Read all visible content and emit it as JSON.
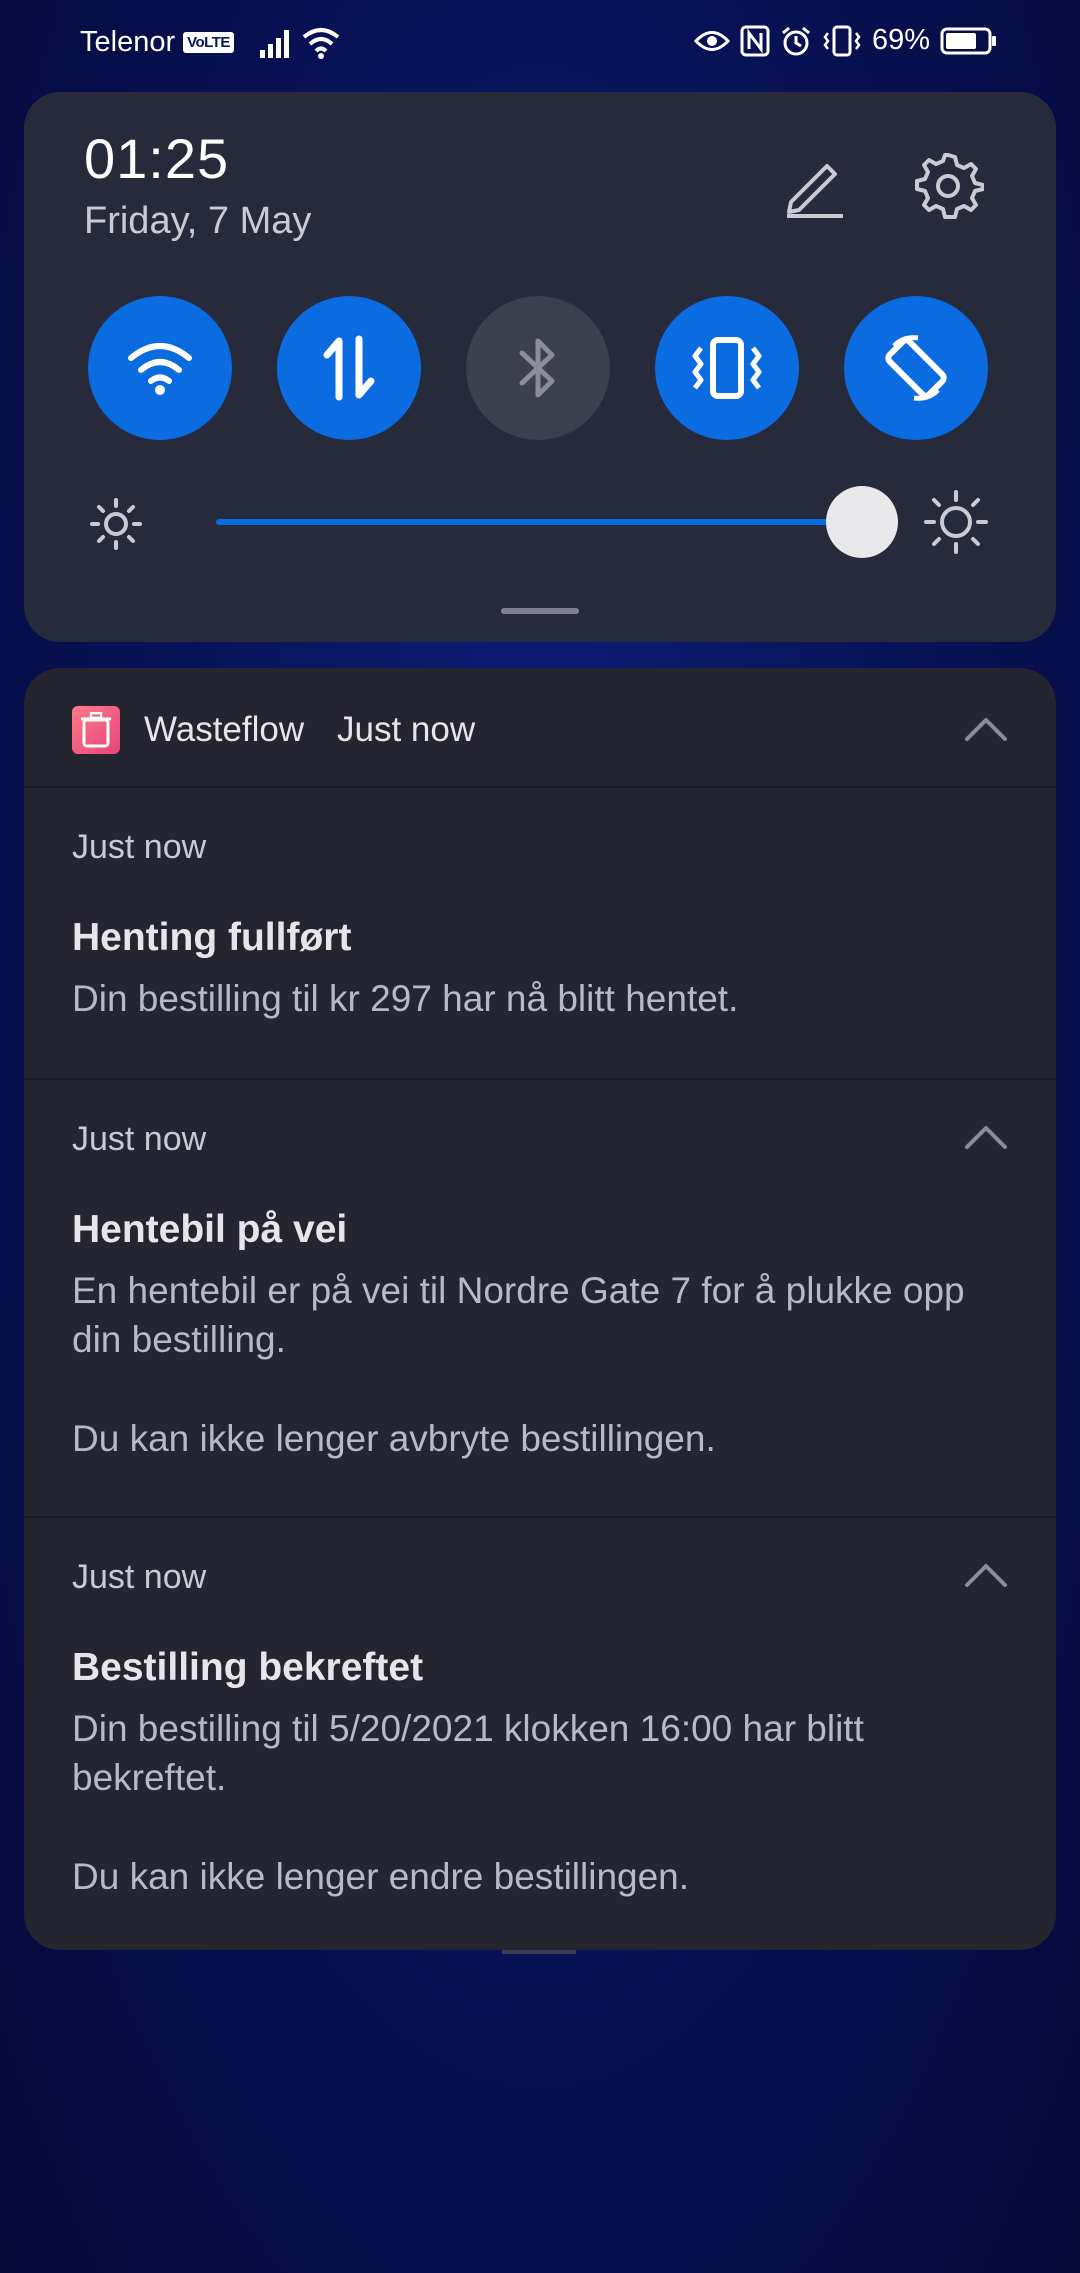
{
  "status_bar": {
    "carrier": "Telenor",
    "volte": "VoLTE",
    "battery": "69%",
    "icons": [
      "signal-icon",
      "wifi-icon",
      "eye-icon",
      "nfc-icon",
      "alarm-icon",
      "vibrate-icon",
      "battery-icon"
    ]
  },
  "quick_settings": {
    "time": "01:25",
    "date": "Friday, 7 May",
    "toggles": [
      {
        "name": "wifi",
        "state": "on"
      },
      {
        "name": "mobile-data",
        "state": "on"
      },
      {
        "name": "bluetooth",
        "state": "off"
      },
      {
        "name": "vibrate",
        "state": "on"
      },
      {
        "name": "auto-rotate",
        "state": "on"
      }
    ],
    "brightness_level": 0.94
  },
  "notification": {
    "app_name": "Wasteflow",
    "app_time": "Just now",
    "items": [
      {
        "time": "Just now",
        "title": "Henting fullført",
        "body": "Din bestilling til kr 297 har nå blitt hentet."
      },
      {
        "time": "Just now",
        "title": "Hentebil på vei",
        "body": "En hentebil er på vei til Nordre Gate 7 for å plukke opp din bestilling.",
        "body2": "Du kan ikke lenger avbryte bestillingen."
      },
      {
        "time": "Just now",
        "title": "Bestilling bekreftet",
        "body": "Din bestilling til 5/20/2021 klokken 16:00 har blitt bekreftet.",
        "body2": "Du kan ikke lenger endre bestillingen."
      }
    ]
  },
  "colors": {
    "accent": "#0b6be0",
    "panel": "#272a3a",
    "card": "#24252f"
  }
}
